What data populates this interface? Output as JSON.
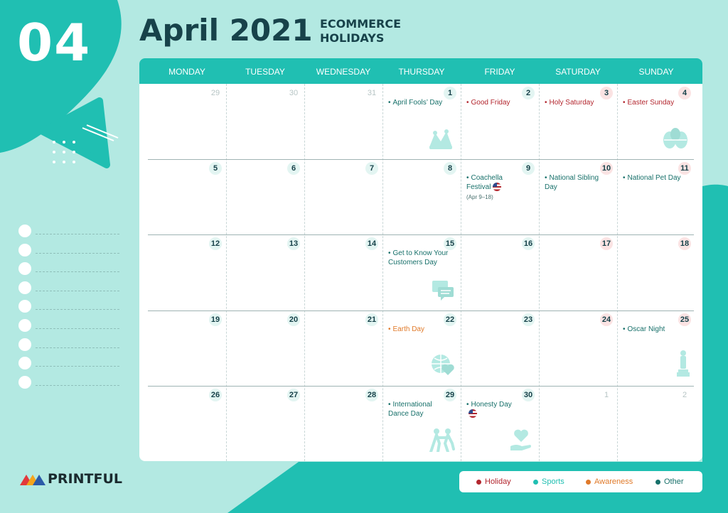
{
  "header": {
    "month_number": "04",
    "title": "April 2021",
    "subtitle_line1": "ECOMMERCE",
    "subtitle_line2": "HOLIDAYS"
  },
  "weekdays": [
    "MONDAY",
    "TUESDAY",
    "WEDNESDAY",
    "THURSDAY",
    "FRIDAY",
    "SATURDAY",
    "SUNDAY"
  ],
  "weeks": [
    [
      {
        "day": "29",
        "type": "other"
      },
      {
        "day": "30",
        "type": "other"
      },
      {
        "day": "31",
        "type": "other"
      },
      {
        "day": "1",
        "type": "cur",
        "event": {
          "text": "April Fools’ Day",
          "category": "other"
        },
        "icon": "jester-hat-icon"
      },
      {
        "day": "2",
        "type": "cur",
        "event": {
          "text": "Good Friday",
          "category": "holiday"
        }
      },
      {
        "day": "3",
        "type": "weekend",
        "event": {
          "text": "Holy Saturday",
          "category": "holiday"
        }
      },
      {
        "day": "4",
        "type": "weekend",
        "event": {
          "text": "Easter Sunday",
          "category": "holiday"
        },
        "icon": "easter-eggs-icon"
      }
    ],
    [
      {
        "day": "5",
        "type": "cur"
      },
      {
        "day": "6",
        "type": "cur"
      },
      {
        "day": "7",
        "type": "cur"
      },
      {
        "day": "8",
        "type": "cur"
      },
      {
        "day": "9",
        "type": "cur",
        "event": {
          "text": "Coachella Festival",
          "category": "other",
          "flag": true,
          "note": "(Apr 9–18)"
        }
      },
      {
        "day": "10",
        "type": "weekend",
        "event": {
          "text": "National Sibling Day",
          "category": "other"
        }
      },
      {
        "day": "11",
        "type": "weekend",
        "event": {
          "text": "National Pet Day",
          "category": "other"
        }
      }
    ],
    [
      {
        "day": "12",
        "type": "cur"
      },
      {
        "day": "13",
        "type": "cur"
      },
      {
        "day": "14",
        "type": "cur"
      },
      {
        "day": "15",
        "type": "cur",
        "event": {
          "text": "Get to Know Your Customers Day",
          "category": "other"
        },
        "icon": "chat-bubbles-icon"
      },
      {
        "day": "16",
        "type": "cur"
      },
      {
        "day": "17",
        "type": "weekend"
      },
      {
        "day": "18",
        "type": "weekend"
      }
    ],
    [
      {
        "day": "19",
        "type": "cur"
      },
      {
        "day": "20",
        "type": "cur"
      },
      {
        "day": "21",
        "type": "cur"
      },
      {
        "day": "22",
        "type": "cur",
        "event": {
          "text": "Earth Day",
          "category": "awareness"
        },
        "icon": "globe-heart-icon"
      },
      {
        "day": "23",
        "type": "cur"
      },
      {
        "day": "24",
        "type": "weekend"
      },
      {
        "day": "25",
        "type": "weekend",
        "event": {
          "text": "Oscar Night",
          "category": "other"
        },
        "icon": "oscar-statue-icon"
      }
    ],
    [
      {
        "day": "26",
        "type": "cur"
      },
      {
        "day": "27",
        "type": "cur"
      },
      {
        "day": "28",
        "type": "cur"
      },
      {
        "day": "29",
        "type": "cur",
        "event": {
          "text": "International Dance Day",
          "category": "other"
        },
        "icon": "dancers-icon"
      },
      {
        "day": "30",
        "type": "cur",
        "event": {
          "text": "Honesty Day",
          "category": "other",
          "flag": true,
          "flag_below": true
        },
        "icon": "heart-hand-icon"
      },
      {
        "day": "1",
        "type": "other"
      },
      {
        "day": "2",
        "type": "other"
      }
    ]
  ],
  "legend": [
    {
      "label": "Holiday",
      "color": "#b3262e"
    },
    {
      "label": "Sports",
      "color": "#20bfb2"
    },
    {
      "label": "Awareness",
      "color": "#e07a2a"
    },
    {
      "label": "Other",
      "color": "#17706a"
    }
  ],
  "brand": {
    "name": "PRINTFUL"
  },
  "colors": {
    "accent": "#20bfb2",
    "dark": "#17424a",
    "holiday": "#b3262e",
    "awareness": "#e07a2a",
    "other": "#17706a"
  }
}
